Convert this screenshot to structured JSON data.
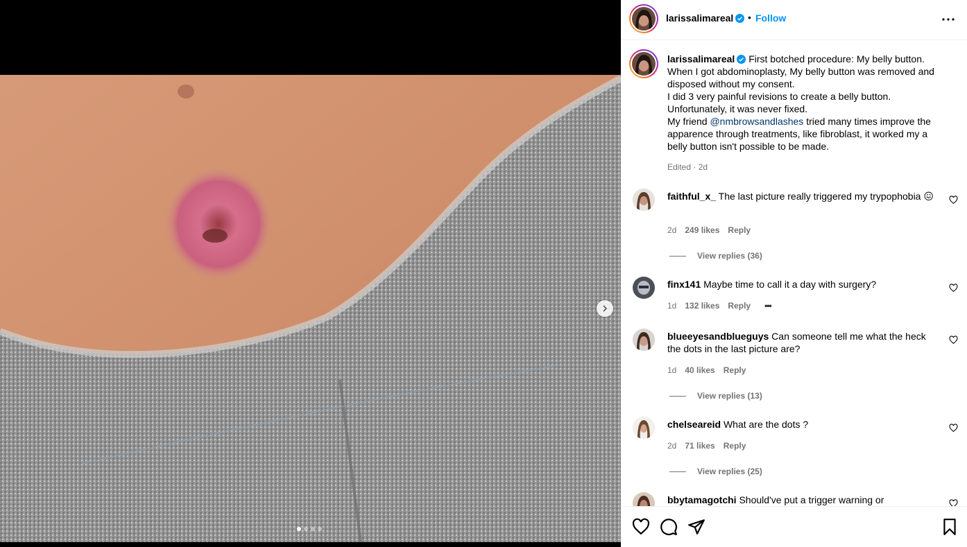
{
  "post": {
    "username": "larissalimareal",
    "separator": "•",
    "follow_label": "Follow",
    "caption_lines_before": "First botched procedure: My belly button.\nWhen I got abdominoplasty, My belly button was removed and disposed without my consent.\nI did 3 very painful revisions to create a belly button.\nUnfortunately, it was never fixed.\nMy friend ",
    "mention": "@nmbrowsandlashes",
    "caption_lines_after": " tried many times improve the apparence through treatments, like fibroblast, it worked my a belly button isn't possible to be made.",
    "edited_time": "Edited · 2d"
  },
  "carousel": {
    "current": 1,
    "total": 4
  },
  "comments": [
    {
      "username": "faithful_x_",
      "text": "The last picture really triggered my trypophobia 😖",
      "time": "2d",
      "likes": "249 likes",
      "reply": "Reply",
      "view_replies": "View replies (36)"
    },
    {
      "username": "finx141",
      "text": "Maybe time to call it a day with surgery?",
      "time": "1d",
      "likes": "132 likes",
      "reply": "Reply",
      "more": "•••"
    },
    {
      "username": "blueeyesandblueguys",
      "text": "Can someone tell me what the heck the dots in the last picture are?",
      "time": "1d",
      "likes": "40 likes",
      "reply": "Reply",
      "view_replies": "View replies (13)"
    },
    {
      "username": "chelseareid",
      "text": "What are the dots ?",
      "time": "2d",
      "likes": "71 likes",
      "reply": "Reply",
      "view_replies": "View replies (25)"
    },
    {
      "username": "bbytamagotchi",
      "text": "Should've put a trigger warning or"
    }
  ],
  "icons": {
    "like": "heart-icon",
    "comment": "comment-bubble-icon",
    "share": "paper-plane-icon",
    "save": "bookmark-icon",
    "more": "more-horizontal-icon",
    "verified": "verified-badge-icon",
    "next": "chevron-right-icon"
  },
  "colors": {
    "accent": "#0095f6",
    "mention": "#00376b",
    "secondary_text": "#737373"
  }
}
